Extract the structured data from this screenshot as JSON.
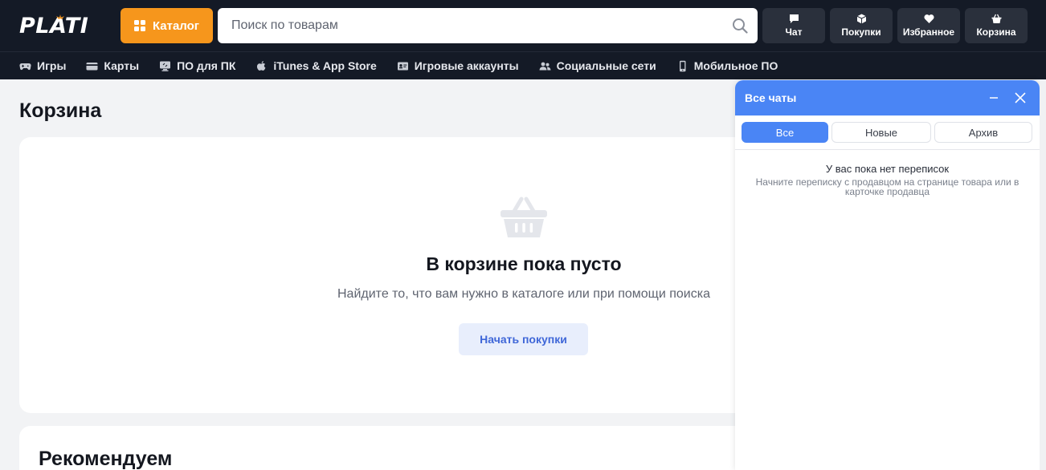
{
  "header": {
    "logo": "PLATI",
    "catalog_label": "Каталог",
    "search_placeholder": "Поиск по товарам",
    "actions": [
      {
        "label": "Чат",
        "icon": "chat-icon"
      },
      {
        "label": "Покупки",
        "icon": "box-icon"
      },
      {
        "label": "Избранное",
        "icon": "heart-icon"
      },
      {
        "label": "Корзина",
        "icon": "basket-icon"
      }
    ]
  },
  "categories": [
    {
      "label": "Игры",
      "icon": "gamepad-icon"
    },
    {
      "label": "Карты",
      "icon": "card-icon"
    },
    {
      "label": "ПО для ПК",
      "icon": "monitor-icon"
    },
    {
      "label": "iTunes & App Store",
      "icon": "apple-icon"
    },
    {
      "label": "Игровые аккаунты",
      "icon": "id-card-icon"
    },
    {
      "label": "Социальные сети",
      "icon": "users-icon"
    },
    {
      "label": "Мобильное ПО",
      "icon": "phone-icon"
    }
  ],
  "main": {
    "page_title": "Корзина",
    "empty_title": "В корзине пока пусто",
    "empty_description": "Найдите то, что вам нужно в каталоге или при помощи поиска",
    "start_button": "Начать покупки",
    "recommend_title": "Рекомендуем"
  },
  "chat": {
    "title": "Все чаты",
    "tabs": [
      {
        "label": "Все",
        "active": true
      },
      {
        "label": "Новые",
        "active": false
      },
      {
        "label": "Архив",
        "active": false
      }
    ],
    "empty_title": "У вас пока нет переписок",
    "empty_description": "Начните переписку с продавцом на странице товара или в карточке продавца"
  },
  "colors": {
    "header_bg": "#141a26",
    "accent_orange": "#f6961c",
    "chat_blue": "#4a85f5",
    "page_bg": "#f2f3f5"
  }
}
